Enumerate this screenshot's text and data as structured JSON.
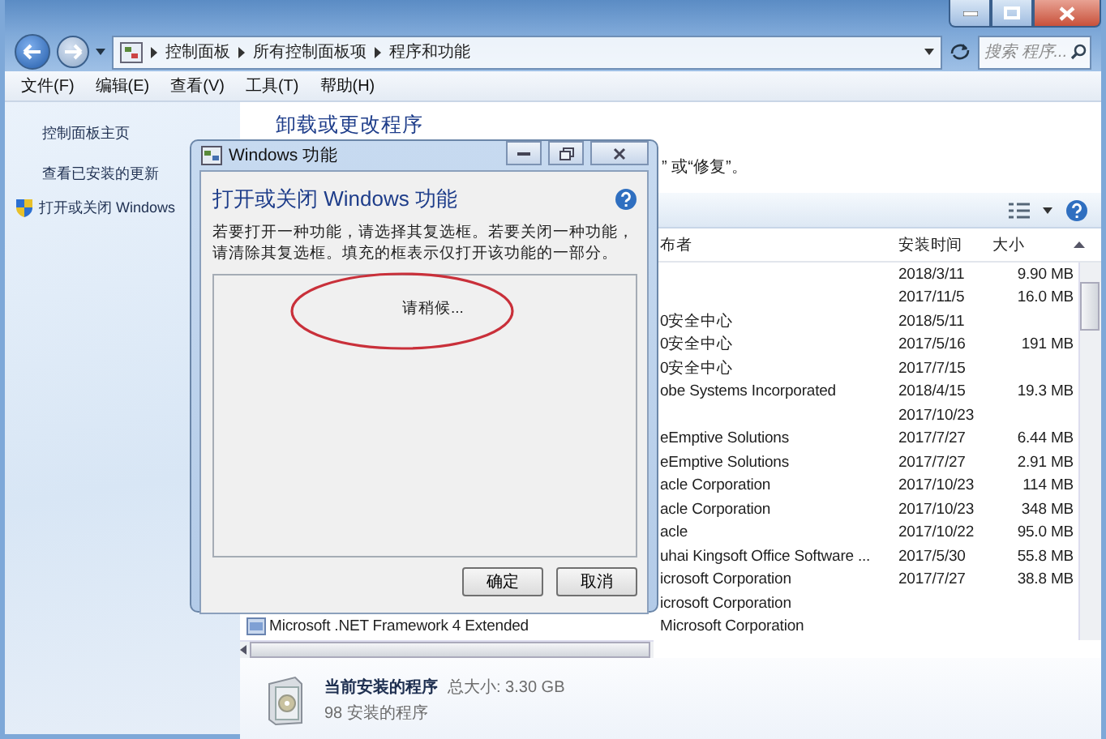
{
  "address_bar": {
    "path": [
      "控制面板",
      "所有控制面板项",
      "程序和功能"
    ],
    "placeholder": "搜索 程序..."
  },
  "menu": [
    "文件(F)",
    "编辑(E)",
    "查看(V)",
    "工具(T)",
    "帮助(H)"
  ],
  "sidebar": {
    "items": [
      {
        "label": "控制面板主页",
        "kind": "link"
      },
      {
        "label": "查看已安装的更新",
        "kind": "link"
      },
      {
        "label": "打开或关闭 Windows",
        "kind": "shield"
      }
    ]
  },
  "main": {
    "title": "卸载或更改程序",
    "subtitle": "” 或“修复”。"
  },
  "table": {
    "columns": [
      "布者",
      "安装时间",
      "大小"
    ],
    "rows": [
      {
        "date": "2018/3/11",
        "size": "9.90 MB"
      },
      {
        "date": "2017/11/5",
        "size": "16.0 MB"
      },
      {
        "publisher": "0安全中心",
        "date": "2018/5/11"
      },
      {
        "publisher": "0安全中心",
        "date": "2017/5/16",
        "size": "191 MB"
      },
      {
        "publisher": "0安全中心",
        "date": "2017/7/15"
      },
      {
        "publisher": "obe Systems Incorporated",
        "date": "2018/4/15",
        "size": "19.3 MB"
      },
      {
        "date": "2017/10/23"
      },
      {
        "publisher": "eEmptive Solutions",
        "date": "2017/7/27",
        "size": "6.44 MB"
      },
      {
        "publisher": "eEmptive Solutions",
        "date": "2017/7/27",
        "size": "2.91 MB"
      },
      {
        "publisher": "acle Corporation",
        "date": "2017/10/23",
        "size": "114 MB"
      },
      {
        "publisher": "acle Corporation",
        "date": "2017/10/23",
        "size": "348 MB"
      },
      {
        "publisher": "acle",
        "date": "2017/10/22",
        "size": "95.0 MB"
      },
      {
        "publisher": "uhai Kingsoft Office Software ...",
        "date": "2017/5/30",
        "size": "55.8 MB"
      },
      {
        "publisher": "icrosoft Corporation",
        "date": "2017/7/27",
        "size": "38.8 MB"
      },
      {
        "publisher": "icrosoft Corporation"
      },
      {
        "name": "Microsoft .NET Framework 4 Extended",
        "publisher": "Microsoft Corporation"
      }
    ]
  },
  "details": {
    "title": "当前安装的程序",
    "total": "总大小: 3.30 GB",
    "count": "98 安装的程序"
  },
  "dialog": {
    "title": "Windows 功能",
    "heading": "打开或关闭 Windows 功能",
    "description": "若要打开一种功能，请选择其复选框。若要关闭一种功能，请清除其复选框。填充的框表示仅打开该功能的一部分。",
    "status": "请稍候...",
    "buttons": [
      "确定",
      "取消"
    ]
  }
}
